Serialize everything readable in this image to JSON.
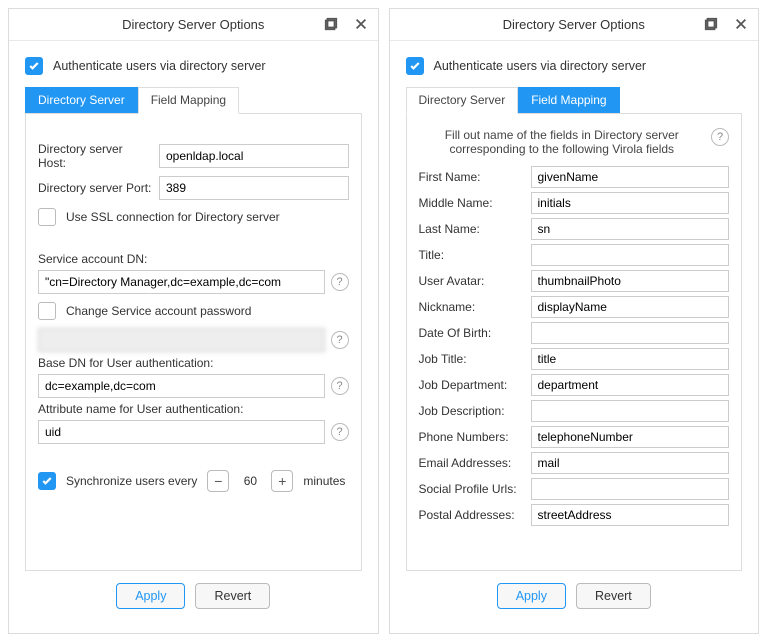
{
  "window_title": "Directory Server Options",
  "auth_checkbox_label": "Authenticate users via directory server",
  "tabs": {
    "directory_server": "Directory Server",
    "field_mapping": "Field Mapping"
  },
  "left": {
    "host_label": "Directory server Host:",
    "host_value": "openldap.local",
    "port_label": "Directory server Port:",
    "port_value": "389",
    "use_ssl_label": "Use SSL connection for Directory server",
    "service_dn_label": "Service account DN:",
    "service_dn_value": "\"cn=Directory Manager,dc=example,dc=com",
    "change_pw_label": "Change Service account password",
    "base_dn_label": "Base DN for User authentication:",
    "base_dn_value": "dc=example,dc=com",
    "attr_label": "Attribute name for User authentication:",
    "attr_value": "uid",
    "sync_label": "Synchronize users every",
    "sync_value": "60",
    "sync_unit": "minutes"
  },
  "right": {
    "instruction": "Fill out name of the fields in Directory server corresponding to the following Virola fields",
    "fields": [
      {
        "label": "First Name:",
        "value": "givenName"
      },
      {
        "label": "Middle Name:",
        "value": "initials"
      },
      {
        "label": "Last Name:",
        "value": "sn"
      },
      {
        "label": "Title:",
        "value": ""
      },
      {
        "label": "User Avatar:",
        "value": "thumbnailPhoto"
      },
      {
        "label": "Nickname:",
        "value": "displayName"
      },
      {
        "label": "Date Of Birth:",
        "value": ""
      },
      {
        "label": "Job Title:",
        "value": "title"
      },
      {
        "label": "Job Department:",
        "value": "department"
      },
      {
        "label": "Job Description:",
        "value": ""
      },
      {
        "label": "Phone Numbers:",
        "value": "telephoneNumber"
      },
      {
        "label": "Email Addresses:",
        "value": "mail"
      },
      {
        "label": "Social Profile Urls:",
        "value": ""
      },
      {
        "label": "Postal Addresses:",
        "value": "streetAddress"
      }
    ]
  },
  "buttons": {
    "apply": "Apply",
    "revert": "Revert"
  }
}
